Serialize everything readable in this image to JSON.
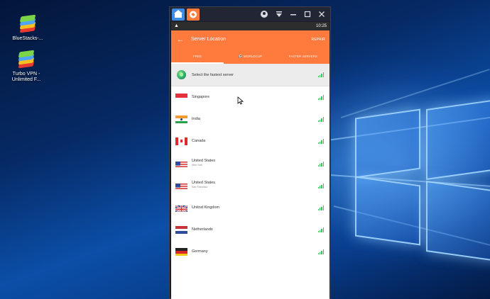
{
  "desktop": {
    "icons": [
      {
        "label": "BlueStacks-..."
      },
      {
        "label_line1": "Turbo VPN -",
        "label_line2": "Unlimited F..."
      }
    ]
  },
  "emulator": {
    "status_time": "10:25"
  },
  "app": {
    "title": "Server Location",
    "repair_label": "REPAIR",
    "tabs": [
      {
        "label": "FREE",
        "active": true
      },
      {
        "label": "WORLDCUP",
        "active": false
      },
      {
        "label": "FASTER SERVERS",
        "active": false
      }
    ],
    "fastest_label": "Select the fastest server",
    "servers": [
      {
        "name": "Singapore",
        "sub": ""
      },
      {
        "name": "India",
        "sub": ""
      },
      {
        "name": "Canada",
        "sub": ""
      },
      {
        "name": "United States",
        "sub": "New York"
      },
      {
        "name": "United States",
        "sub": "San Francisco"
      },
      {
        "name": "Unitnd Kingdom",
        "sub": ""
      },
      {
        "name": "Netherlands",
        "sub": ""
      },
      {
        "name": "Germany",
        "sub": ""
      }
    ]
  },
  "colors": {
    "accent": "#ff7a3d",
    "signal": "#3cc45a"
  }
}
